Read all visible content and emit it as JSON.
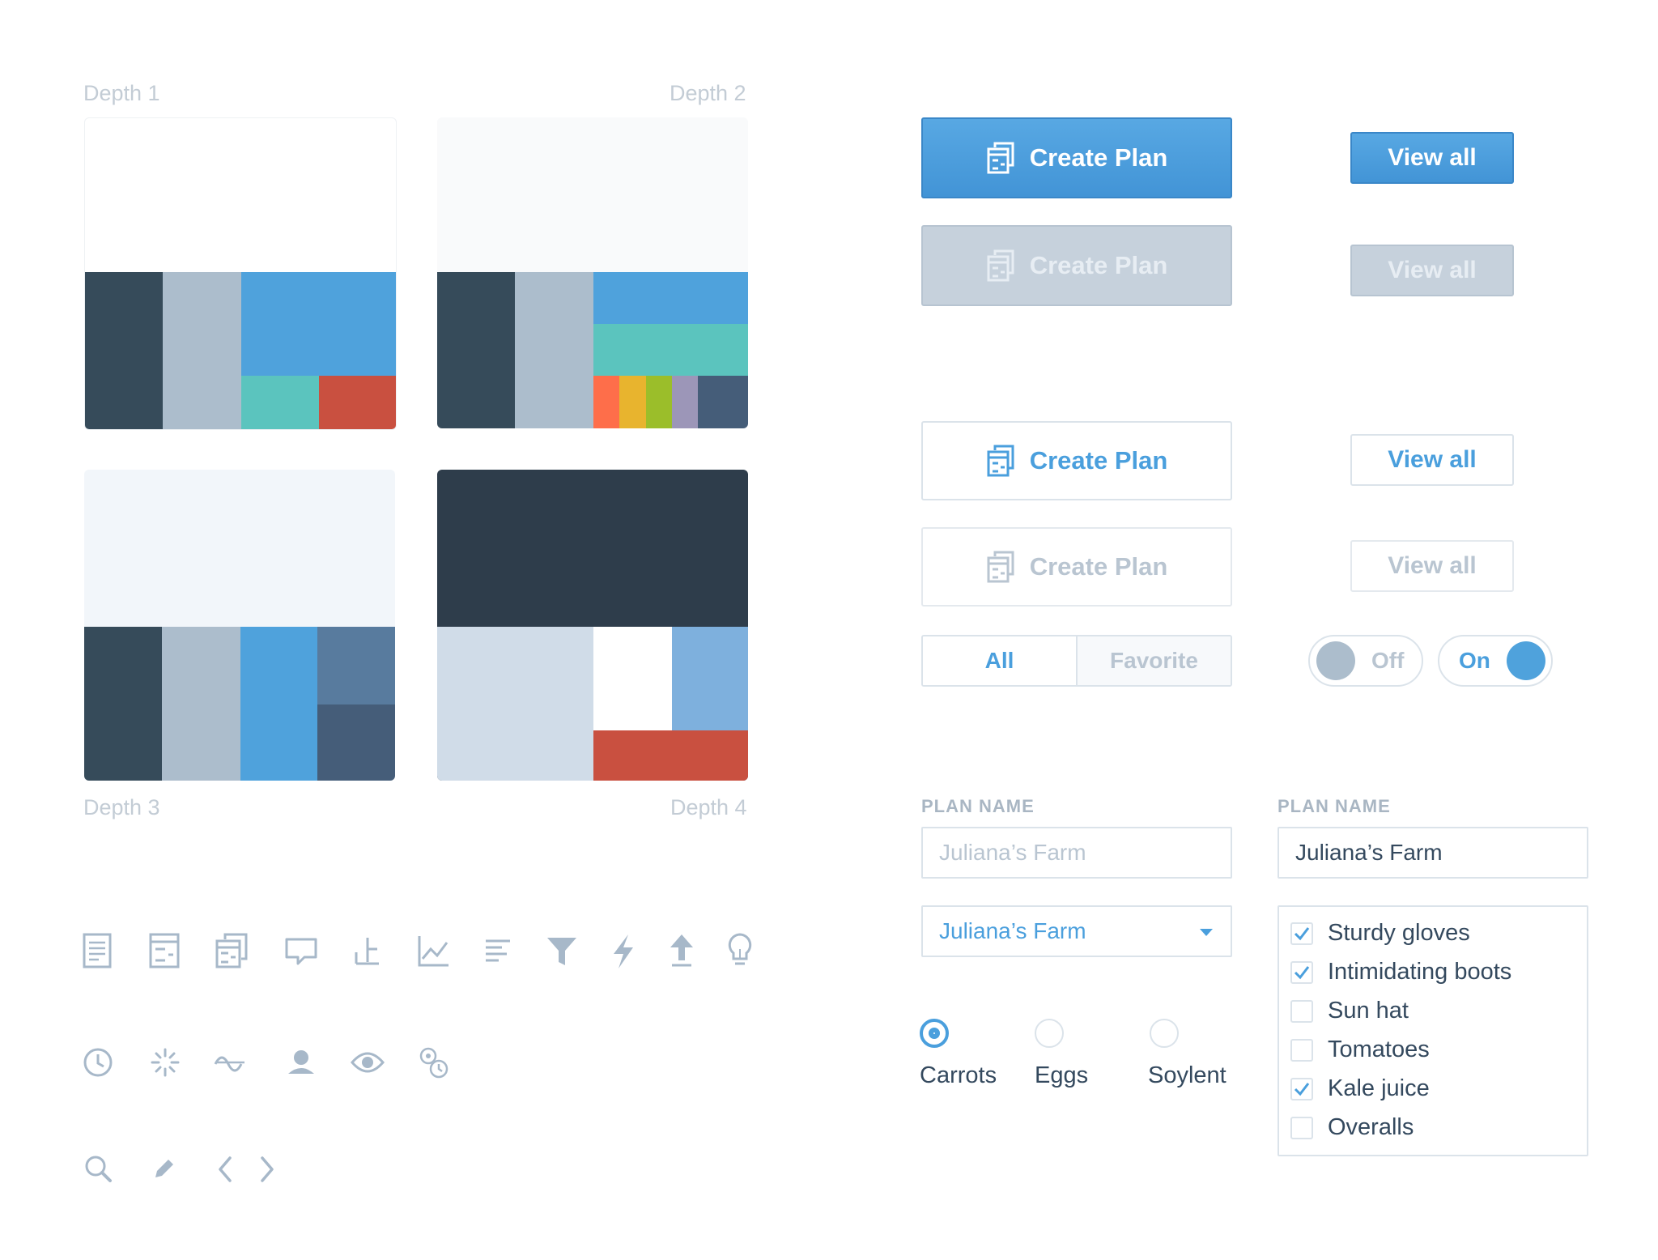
{
  "depth_labels": {
    "d1": "Depth 1",
    "d2": "Depth 2",
    "d3": "Depth 3",
    "d4": "Depth 4"
  },
  "buttons": {
    "create_plan": "Create Plan",
    "view_all": "View all"
  },
  "segmented": {
    "all": "All",
    "favorite": "Favorite"
  },
  "toggles": {
    "off": "Off",
    "on": "On"
  },
  "form": {
    "plan_name_label": "PLAN NAME",
    "plan_name_placeholder": "Juliana’s Farm",
    "plan_name_value": "Juliana’s Farm",
    "select_value": "Juliana’s Farm"
  },
  "radios": [
    {
      "label": "Carrots",
      "selected": true
    },
    {
      "label": "Eggs",
      "selected": false
    },
    {
      "label": "Soylent",
      "selected": false
    }
  ],
  "checklist": [
    {
      "label": "Sturdy gloves",
      "checked": true
    },
    {
      "label": "Intimidating boots",
      "checked": true
    },
    {
      "label": "Sun hat",
      "checked": false
    },
    {
      "label": "Tomatoes",
      "checked": false
    },
    {
      "label": "Kale juice",
      "checked": true
    },
    {
      "label": "Overalls",
      "checked": false
    }
  ],
  "colors": {
    "dark": "#364b5a",
    "gray": "#acbdcc",
    "blue": "#4fa2dc",
    "teal": "#5bc4be",
    "red": "#c95040",
    "orange": "#fe6e4a",
    "yellow": "#e8b42e",
    "green": "#9bbe2a",
    "purple": "#9c96b8",
    "slate": "#455d79",
    "steel": "#587b9e",
    "navy": "#2e3d4b",
    "light_blue": "#7eb0dd",
    "pale": "#d0dce8",
    "icon": "#a7b8c9"
  },
  "icons_row1": [
    "document-icon",
    "plan-icon",
    "plans-stack-icon",
    "comment-icon",
    "signpost-icon",
    "chart-icon",
    "align-left-icon",
    "filter-icon",
    "lightning-icon",
    "upload-icon",
    "lightbulb-icon"
  ],
  "icons_row2": [
    "clock-icon",
    "spinner-icon",
    "wave-icon",
    "user-icon",
    "eye-icon",
    "gears-clock-icon"
  ],
  "icons_row3": [
    "search-icon",
    "pencil-icon",
    "chevron-left-icon",
    "chevron-right-icon"
  ]
}
